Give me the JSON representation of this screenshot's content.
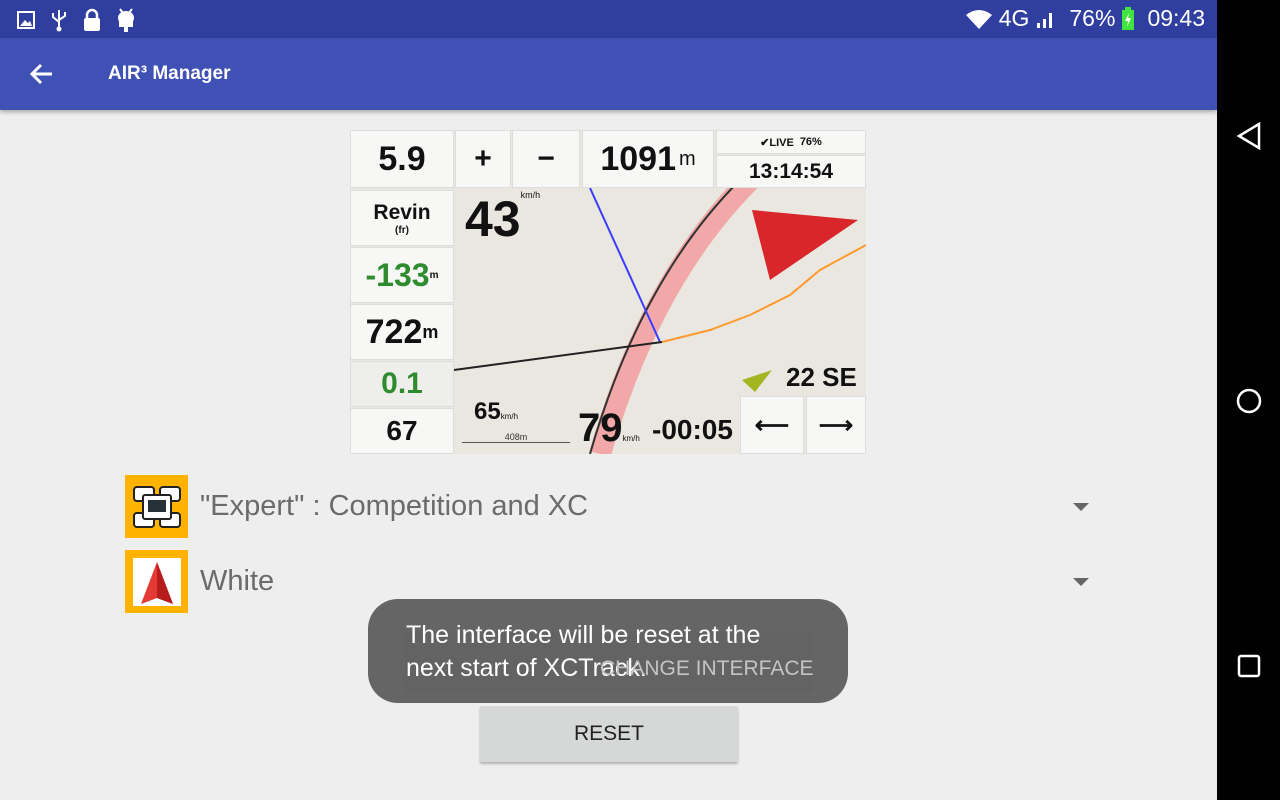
{
  "status_bar": {
    "icons": [
      "image-icon",
      "usb-icon",
      "lock-icon",
      "android-icon"
    ],
    "network": "4G",
    "battery": "76%",
    "time": "09:43"
  },
  "app_bar": {
    "title": "AIR³ Manager",
    "back_icon": "arrow-left-icon"
  },
  "preview": {
    "glide_ratio": "5.9",
    "plus": "+",
    "minus": "−",
    "altitude": "1091",
    "altitude_unit": "m",
    "live": "✔LIVE",
    "battery": "76%",
    "clock": "13:14:54",
    "waypoint": "Revin",
    "waypoint_sub": "(fr)",
    "speed": "43",
    "speed_unit": "km/h",
    "relative": "-133",
    "relative_unit": "m",
    "height": "722",
    "height_unit": "m",
    "glide_to_goal": "0.1",
    "glide_value": "67",
    "scale_speed": "65",
    "scale_unit": "km/h",
    "scale": "408m",
    "ground_speed": "79",
    "gs_unit": "km/h",
    "time_to_start": "-00:05",
    "wind": "22",
    "wind_dir": "SE",
    "nav_prev": "⟵",
    "nav_next": "⟶"
  },
  "interface_select": {
    "value": "\"Expert\" : Competition and XC",
    "icon": "layout-icon"
  },
  "theme_select": {
    "value": "White",
    "icon": "compass-arrow-icon"
  },
  "buttons": {
    "change_interface": "CHANGE INTERFACE",
    "reset": "RESET"
  },
  "toast": {
    "message": "The interface will be reset at the next start of XCTrack."
  },
  "colors": {
    "status_bar": "#303f9f",
    "app_bar": "#3f51b5",
    "icon_bg": "#ffb300"
  }
}
